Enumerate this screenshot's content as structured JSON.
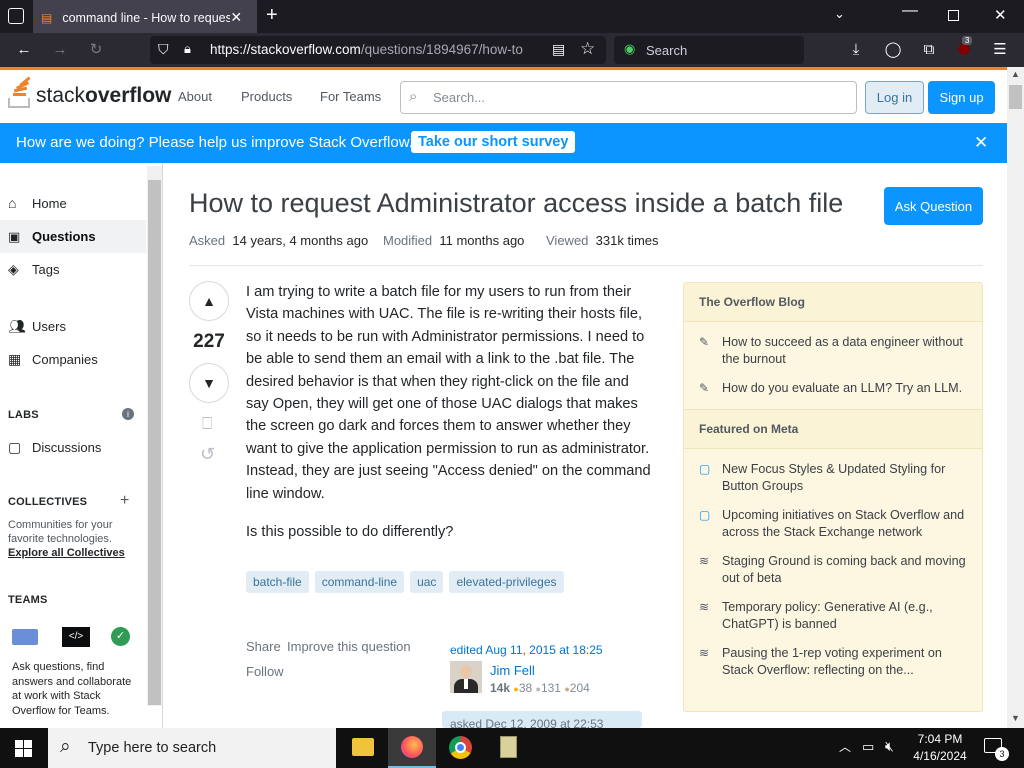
{
  "browser": {
    "tab_title": "command line - How to request",
    "url_main": "https://stackoverflow.com",
    "url_path": "/questions/1894967/how-to",
    "search_placeholder": "Search",
    "ext_badge": "3"
  },
  "header": {
    "logo_text1": "stack",
    "logo_text2": "overflow",
    "nav": [
      "About",
      "Products",
      "For Teams"
    ],
    "search_placeholder": "Search...",
    "login": "Log in",
    "signup": "Sign up"
  },
  "banner": {
    "text": "How are we doing? Please help us improve Stack Overflow.",
    "link": "Take our short survey",
    "close": "✕"
  },
  "leftnav": {
    "items": [
      {
        "icon": "home-icon",
        "label": "Home"
      },
      {
        "icon": "questions-icon",
        "label": "Questions"
      },
      {
        "icon": "tag-icon",
        "label": "Tags"
      },
      {
        "icon": "users-icon",
        "label": "Users"
      },
      {
        "icon": "companies-icon",
        "label": "Companies"
      }
    ],
    "labs": "LABS",
    "discussions": "Discussions",
    "collectives": "COLLECTIVES",
    "collectives_desc": "Communities for your favorite technologies.",
    "collectives_link": "Explore all Collectives",
    "teams": "TEAMS",
    "teams_desc": "Ask questions, find answers and collaborate at work with Stack Overflow for Teams."
  },
  "question": {
    "title": "How to request Administrator access inside a batch file",
    "ask_button": "Ask Question",
    "asked_label": "Asked",
    "asked_value": "14 years, 4 months ago",
    "modified_label": "Modified",
    "modified_value": "11 months ago",
    "viewed_label": "Viewed",
    "viewed_value": "331k times",
    "score": "227",
    "body_p1": "I am trying to write a batch file for my users to run from their Vista machines with UAC. The file is re-writing their hosts file, so it needs to be run with Administrator permissions. I need to be able to send them an email with a link to the .bat file. The desired behavior is that when they right-click on the file and say Open, they will get one of those UAC dialogs that makes the screen go dark and forces them to answer whether they want to give the application permission to run as administrator. Instead, they are just seeing \"Access denied\" on the command line window.",
    "body_p2": "Is this possible to do differently?",
    "tags": [
      "batch-file",
      "command-line",
      "uac",
      "elevated-privileges"
    ],
    "share": "Share",
    "improve": "Improve this question",
    "follow": "Follow",
    "edited": "edited Aug 11, 2015 at 18:25",
    "editor": "Jim Fell",
    "rep": "14k",
    "gold": "38",
    "silver": "131",
    "bronze": "204",
    "asked_partial": "asked Dec 12, 2009 at 22:53"
  },
  "sidebar": {
    "blog_title": "The Overflow Blog",
    "blog": [
      "How to succeed as a data engineer without the burnout",
      "How do you evaluate an LLM? Try an LLM."
    ],
    "meta_title": "Featured on Meta",
    "meta": [
      {
        "icon": "chat-icon",
        "text": "New Focus Styles & Updated Styling for Button Groups"
      },
      {
        "icon": "chat-icon",
        "text": "Upcoming initiatives on Stack Overflow and across the Stack Exchange network"
      },
      {
        "icon": "stack-icon",
        "text": "Staging Ground is coming back and moving out of beta"
      },
      {
        "icon": "stack-icon",
        "text": "Temporary policy: Generative AI (e.g., ChatGPT) is banned"
      },
      {
        "icon": "stack-icon",
        "text": "Pausing the 1-rep voting experiment on Stack Overflow: reflecting on the..."
      }
    ]
  },
  "taskbar": {
    "search_placeholder": "Type here to search",
    "time": "7:04 PM",
    "date": "4/16/2024",
    "notif": "3"
  }
}
